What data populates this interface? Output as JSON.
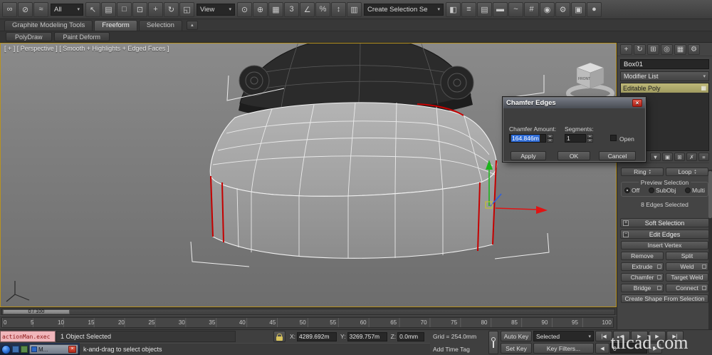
{
  "colors": {
    "viewport_border": "#b8921f",
    "selection_highlight": "#2f6cd6",
    "stack_highlight": "#b5b074",
    "selected_edge": "#c40000",
    "listener_bg": "#f0b6bb"
  },
  "toolbar": {
    "filter_dropdown": "All",
    "coord_system_dropdown": "View",
    "selection_set_dropdown": "Create Selection Se",
    "icons_left": [
      {
        "name": "select-and-link-icon",
        "glyph": "∞"
      },
      {
        "name": "unlink-selection-icon",
        "glyph": "⊘"
      },
      {
        "name": "bind-to-space-warp-icon",
        "glyph": "≈"
      }
    ],
    "icons_select": [
      {
        "name": "select-object-icon",
        "glyph": "↖"
      },
      {
        "name": "select-by-name-icon",
        "glyph": "▤"
      },
      {
        "name": "rectangular-selection-icon",
        "glyph": "□"
      },
      {
        "name": "window-crossing-icon",
        "glyph": "⊡"
      },
      {
        "name": "select-and-move-icon",
        "glyph": "+"
      },
      {
        "name": "select-and-rotate-icon",
        "glyph": "↻"
      },
      {
        "name": "select-and-scale-icon",
        "glyph": "◱"
      }
    ],
    "icons_center": [
      {
        "name": "use-pivot-center-icon",
        "glyph": "⊙"
      },
      {
        "name": "select-and-manipulate-icon",
        "glyph": "⊕"
      },
      {
        "name": "keyboard-override-icon",
        "glyph": "▦"
      },
      {
        "name": "snaps-toggle-icon",
        "glyph": "3"
      },
      {
        "name": "angle-snap-icon",
        "glyph": "∠"
      },
      {
        "name": "percent-snap-icon",
        "glyph": "%"
      },
      {
        "name": "spinner-snap-icon",
        "glyph": "↕"
      },
      {
        "name": "named-selection-sets-icon",
        "glyph": "▥"
      }
    ],
    "icons_right": [
      {
        "name": "mirror-icon",
        "glyph": "◧"
      },
      {
        "name": "align-icon",
        "glyph": "≡"
      },
      {
        "name": "layer-manager-icon",
        "glyph": "▤"
      },
      {
        "name": "graphite-toggle-icon",
        "glyph": "▬"
      },
      {
        "name": "curve-editor-icon",
        "glyph": "~"
      },
      {
        "name": "schematic-view-icon",
        "glyph": "#"
      },
      {
        "name": "material-editor-icon",
        "glyph": "◉"
      },
      {
        "name": "render-setup-icon",
        "glyph": "⚙"
      },
      {
        "name": "rendered-frame-icon",
        "glyph": "▣"
      },
      {
        "name": "render-production-icon",
        "glyph": "●"
      }
    ]
  },
  "ribbon": {
    "tabs": [
      {
        "label": "Graphite Modeling Tools"
      },
      {
        "label": "Freeform"
      },
      {
        "label": "Selection"
      }
    ],
    "panels": [
      {
        "label": "PolyDraw"
      },
      {
        "label": "Paint Deform"
      }
    ]
  },
  "viewport": {
    "label": "[ + ] [ Perspective ] [ Smooth + Highlights + Edged Faces ]",
    "viewcube_label": "FRONT"
  },
  "chamfer_dialog": {
    "title": "Chamfer Edges",
    "amount_label": "Chamfer Amount:",
    "amount_value": "164.846m",
    "segments_label": "Segments:",
    "segments_value": "1",
    "open_label": "Open",
    "apply_label": "Apply",
    "ok_label": "OK",
    "cancel_label": "Cancel"
  },
  "command_panel": {
    "tabs": [
      {
        "name": "create-tab-icon",
        "glyph": "+"
      },
      {
        "name": "modify-tab-icon",
        "glyph": "↻"
      },
      {
        "name": "hierarchy-tab-icon",
        "glyph": "⊞"
      },
      {
        "name": "motion-tab-icon",
        "glyph": "◎"
      },
      {
        "name": "display-tab-icon",
        "glyph": "▦"
      },
      {
        "name": "utilities-tab-icon",
        "glyph": "⚙"
      }
    ],
    "object_name": "Box01",
    "modifier_list_label": "Modifier List",
    "stack_selected": "Editable Poly",
    "stack_tools": [
      {
        "name": "pin-stack-icon",
        "glyph": "▼"
      },
      {
        "name": "show-end-result-icon",
        "glyph": "▣"
      },
      {
        "name": "make-unique-icon",
        "glyph": "⊞"
      },
      {
        "name": "remove-modifier-icon",
        "glyph": "✗"
      },
      {
        "name": "configure-sets-icon",
        "glyph": "≡"
      }
    ],
    "ring_label": "Ring",
    "loop_label": "Loop",
    "preview_group": {
      "title": "Preview Selection",
      "off": "Off",
      "subobj": "SubObj",
      "multi": "Multi"
    },
    "selection_status": "8 Edges Selected",
    "soft_selection": "Soft Selection",
    "edit_edges": "Edit Edges",
    "buttons": {
      "insert_vertex": "Insert Vertex",
      "remove": "Remove",
      "split": "Split",
      "extrude": "Extrude",
      "weld": "Weld",
      "chamfer": "Chamfer",
      "target_weld": "Target Weld",
      "bridge": "Bridge",
      "connect": "Connect",
      "create_shape": "Create Shape From Selection"
    }
  },
  "timeline": {
    "slider_label": "0 / 100",
    "ticks": [
      "0",
      "5",
      "10",
      "15",
      "20",
      "25",
      "30",
      "35",
      "40",
      "45",
      "50",
      "55",
      "60",
      "65",
      "70",
      "75",
      "80",
      "85",
      "90",
      "95",
      "100"
    ]
  },
  "status_bar": {
    "listener_text": "actionMan.exec",
    "selection_text": "1 Object Selected",
    "prompt_text": "k-and-drag to select objects",
    "x_label": "X:",
    "x_value": "4289.692m",
    "y_label": "Y:",
    "y_value": "3269.757m",
    "z_label": "Z:",
    "z_value": "0.0mm",
    "grid_text": "Grid = 254.0mm",
    "add_time_tag": "Add Time Tag",
    "auto_key": "Auto Key",
    "set_key": "Set Key",
    "selected_dropdown": "Selected",
    "key_filters": "Key Filters...",
    "frame_field": "0",
    "playback_row1": [
      {
        "name": "go-to-start-icon",
        "glyph": "|◀"
      },
      {
        "name": "previous-frame-icon",
        "glyph": "◀"
      },
      {
        "name": "play-icon",
        "glyph": "▶"
      },
      {
        "name": "next-frame-icon",
        "glyph": "▶"
      },
      {
        "name": "go-to-end-icon",
        "glyph": "▶|"
      }
    ],
    "taskbar_window": "M...",
    "watermark": "tilcad.com"
  }
}
